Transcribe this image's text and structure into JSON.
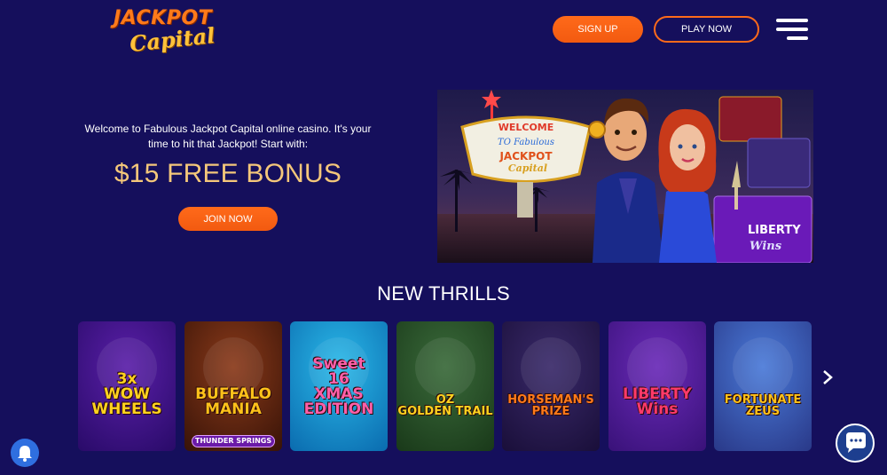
{
  "header": {
    "logo_line1": "JACKPOT",
    "logo_line2": "Capital",
    "signup_label": "SIGN UP",
    "playnow_label": "PLAY NOW",
    "menu_icon": "hamburger-menu-icon"
  },
  "hero": {
    "text": "Welcome to Fabulous Jackpot Capital online casino. It's your time to hit that Jackpot! Start with:",
    "bonus": "$15 FREE BONUS",
    "join_label": "JOIN NOW",
    "banner": {
      "sign_welcome": "WELCOME",
      "sign_to": "TO Fabulous",
      "sign_jackpot": "JACKPOT",
      "sign_capital": "Capital",
      "liberty": "LIBERTY",
      "wins": "Wins"
    }
  },
  "section": {
    "title": "NEW THRILLS"
  },
  "games": [
    {
      "name": "wow-wheels",
      "title": "3x\nWOW\nWHEELS",
      "bg1": "#5a1fa8",
      "bg2": "#2a0b6a",
      "color": "#ffd21f"
    },
    {
      "name": "buffalo-mania",
      "title": "BUFFALO\nMANIA",
      "subtitle": "THUNDER SPRINGS",
      "bg1": "#8a3a1a",
      "bg2": "#3a1408",
      "color": "#ffc21a"
    },
    {
      "name": "sweet-16-xmas",
      "title": "Sweet\n16\nXMAS\nEDITION",
      "bg1": "#2ab8e8",
      "bg2": "#0b6db0",
      "color": "#ff5fa8"
    },
    {
      "name": "oz-golden-trail",
      "title": "OZ\nGOLDEN TRAIL",
      "bg1": "#3a6a3a",
      "bg2": "#1a3a1a",
      "color": "#ffd21f"
    },
    {
      "name": "horsemans-prize",
      "title": "HORSEMAN'S\nPRIZE",
      "bg1": "#3a2a6a",
      "bg2": "#1a0f3a",
      "color": "#ff7a1a"
    },
    {
      "name": "liberty-wins",
      "title": "LIBERTY\nWins",
      "bg1": "#6a2ab8",
      "bg2": "#3a127a",
      "color": "#ff3a6a"
    },
    {
      "name": "fortunate-zeus",
      "title": "FORTUNATE\nZEUS",
      "bg1": "#4a7ad8",
      "bg2": "#2a3a8a",
      "color": "#ffc21a"
    }
  ],
  "icons": {
    "next": "chevron-right-icon",
    "bell": "bell-icon",
    "chat": "chat-icon"
  },
  "colors": {
    "background": "#150f5c",
    "accent": "#ff6a1a",
    "bonus": "#f4c77a"
  }
}
